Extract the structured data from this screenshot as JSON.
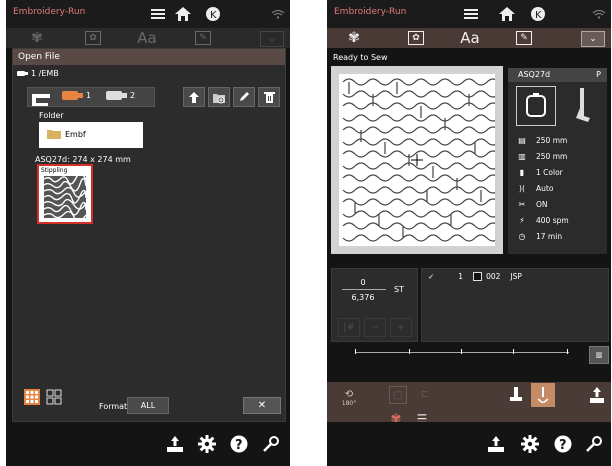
{
  "left": {
    "app_title": "Embroidery-Run",
    "dialog": {
      "title": "Open File",
      "path": "1 /EMB",
      "usb_slots": [
        "1",
        "2"
      ],
      "folder_label": "Folder",
      "folder_name": "Embf",
      "design_caption": "ASQ27d: 274 x 274 mm",
      "design_name": "Stippling",
      "format_label": "Format",
      "format_value": "ALL",
      "close_label": "✕"
    }
  },
  "right": {
    "app_title": "Embroidery-Run",
    "toolbar": {
      "text_tool": "Aa"
    },
    "status": "Ready to Sew",
    "design_info": {
      "name": "ASQ27d",
      "tag": "P",
      "width": "250 mm",
      "height": "250 mm",
      "colors": "1 Color",
      "tension": "Auto",
      "cut": "ON",
      "speed": "400 spm",
      "time": "17 min"
    },
    "counter": {
      "current": "0",
      "total": "6,376",
      "unit": "ST"
    },
    "color_list": [
      {
        "index": "1",
        "code": "002",
        "brand": "JSP"
      }
    ],
    "rotate_label": "180°"
  },
  "colors": {
    "accent": "#5a4a46",
    "highlight": "#d3302c",
    "usb_orange": "#e8843f",
    "active_tool": "#c48b67"
  }
}
